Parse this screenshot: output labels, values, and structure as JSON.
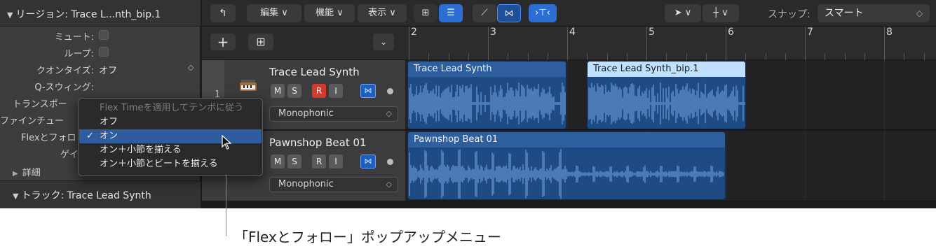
{
  "inspector": {
    "region_header": "リージョン: Trace L...nth_bip.1",
    "rows": [
      {
        "label": "ミュート:",
        "value": ""
      },
      {
        "label": "ループ:",
        "value": ""
      },
      {
        "label": "クオンタイズ:",
        "value": "オフ"
      },
      {
        "label": "Q-スウィング:",
        "value": ""
      },
      {
        "label": "トランスポー",
        "value": ""
      },
      {
        "label": "ファインチュー",
        "value": ""
      },
      {
        "label": "Flexとフォロ",
        "value": ""
      },
      {
        "label": "ゲイ",
        "value": ""
      }
    ],
    "details": "詳細",
    "track_header": "トラック: Trace Lead Synth"
  },
  "toolbar": {
    "edit": "編集",
    "functions": "機能",
    "view": "表示",
    "snap_label": "スナップ:",
    "snap_value": "スマート"
  },
  "popup": {
    "items": [
      {
        "label": "Flex Timeを適用してテンポに従う",
        "disabled": true
      },
      {
        "label": "オフ"
      },
      {
        "label": "オン",
        "checked": true
      },
      {
        "label": "オン＋小節を揃える"
      },
      {
        "label": "オン＋小節とビートを揃える"
      }
    ]
  },
  "ruler": {
    "bars": [
      "2",
      "3",
      "4",
      "5",
      "6",
      "7",
      "8"
    ]
  },
  "tracks": [
    {
      "number": "1",
      "name": "Trace Lead Synth",
      "mode": "Monophonic",
      "mute": "M",
      "solo": "S",
      "record": "R",
      "input": "I"
    },
    {
      "number": "",
      "name": "Pawnshop Beat 01",
      "mode": "Monophonic",
      "mute": "M",
      "solo": "S",
      "record": "R",
      "input": "I"
    }
  ],
  "regions": [
    {
      "name": "Trace Lead Synth"
    },
    {
      "name": "Trace Lead Synth_bip.1"
    },
    {
      "name": "Pawnshop Beat 01"
    }
  ],
  "caption": "「Flexとフォロー」ポップアップメニュー",
  "colors": {
    "accent": "#2c6ed4",
    "region": "#1e4b84",
    "region_selected_header": "#bfe0ff",
    "record": "#d23a2e"
  }
}
